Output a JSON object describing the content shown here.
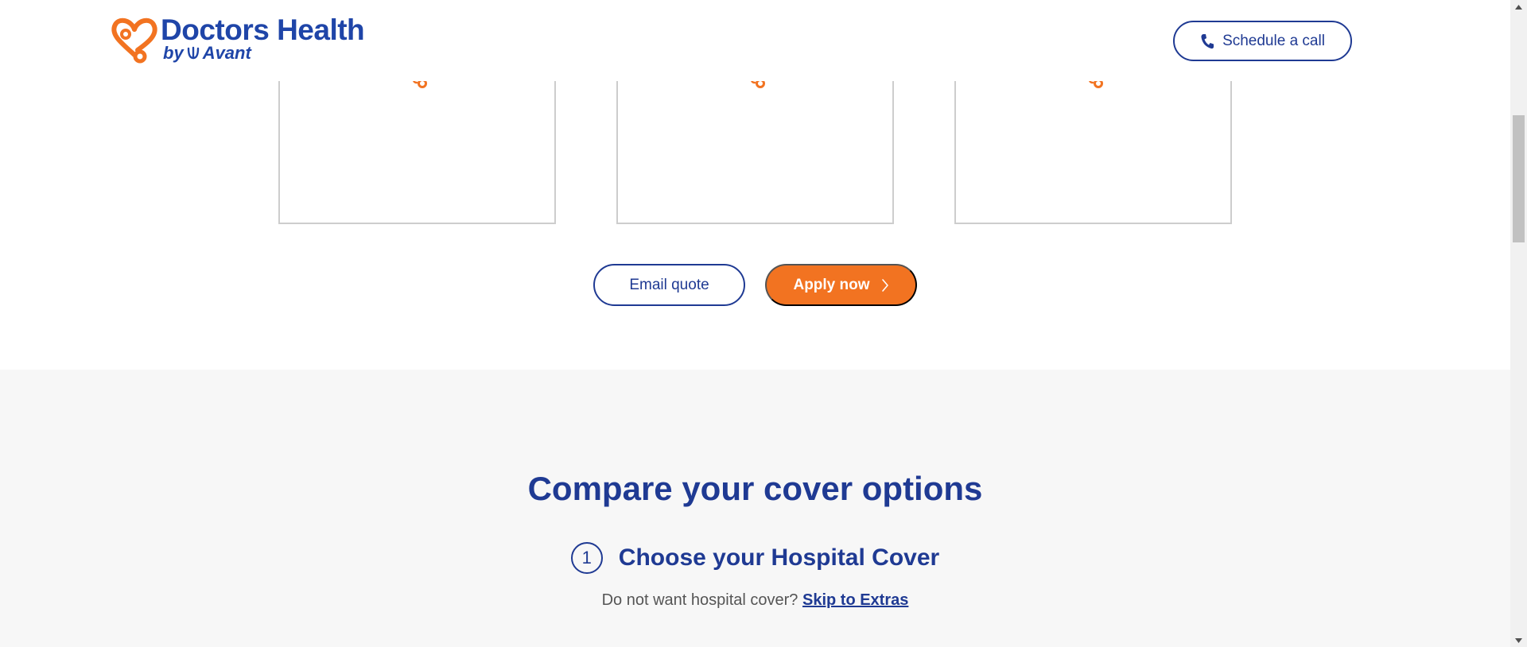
{
  "header": {
    "logo_title": "Doctors Health",
    "logo_sub_by": "by",
    "logo_sub_brand": "Avant",
    "schedule_label": "Schedule a call"
  },
  "actions": {
    "email_label": "Email quote",
    "apply_label": "Apply now"
  },
  "compare": {
    "title_strong": "Compare",
    "title_rest": " your cover options",
    "step_number": "1",
    "step_title": "Choose your Hospital Cover",
    "skip_prefix": "Do not want hospital cover?",
    "skip_link": "Skip to Extras"
  },
  "colors": {
    "brand_blue": "#1f3a93",
    "brand_orange": "#f27321",
    "section_bg": "#f7f7f7",
    "card_border": "#cdcdcd"
  },
  "icons": {
    "logo": "heart-stethoscope-icon",
    "phone": "phone-icon",
    "card": "stethoscope-icon",
    "apply": "chevron-right-icon"
  }
}
